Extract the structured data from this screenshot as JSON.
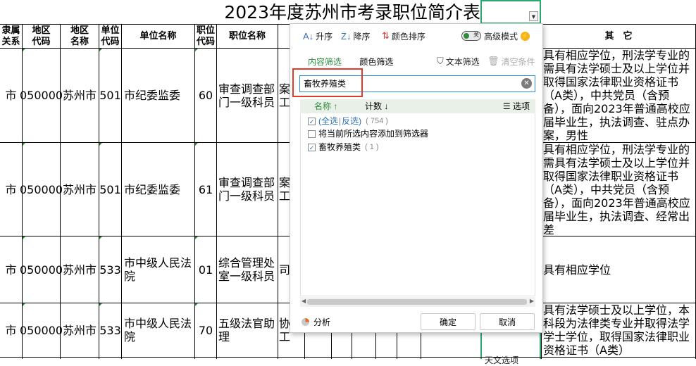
{
  "title": "2023年度苏州市考录职位简介表",
  "headers": {
    "jsgx": "隶属关系",
    "dqdm": "地区代码",
    "dqmc": "地区名称",
    "dwdm": "单位代码",
    "dwmc": "单位名称",
    "zwdm": "职位代码",
    "zwmc": "职位名称",
    "qt": "其　它"
  },
  "rows": [
    {
      "rel": "市",
      "area_code": "050000",
      "area": "苏州市",
      "unit_code": "501",
      "unit": "市纪委监委",
      "pos_code": "60",
      "pos": "审查调查部门一级科员",
      "fragment": "案工",
      "other": "具有相应学位，刑法学专业的需具有法学硕士及以上学位并取得国家法律职业资格证书（A类），中共党员（含预备），面向2023年普通高校应届毕业生，执法调查、驻点办案，男性"
    },
    {
      "rel": "市",
      "area_code": "050000",
      "area": "苏州市",
      "unit_code": "501",
      "unit": "市纪委监委",
      "pos_code": "61",
      "pos": "审查调查部门一级科员",
      "fragment": "案工",
      "other": "具有相应学位，刑法学专业的需具有法学硕士及以上学位并取得国家法律职业资格证书（A类），中共党员（含预备），面向2023年普通高校应届毕业生，执法调查、经常出差"
    },
    {
      "rel": "市",
      "area_code": "050000",
      "area": "苏州市",
      "unit_code": "533",
      "unit": "市中级人民法院",
      "pos_code": "01",
      "pos": "综合管理处室一级科员",
      "fragment": "司",
      "other": "具有相应学位"
    },
    {
      "rel": "市",
      "area_code": "050000",
      "area": "苏州市",
      "unit_code": "533",
      "unit": "市中级人民法院",
      "pos_code": "70",
      "pos": "五级法官助理",
      "fragment": "协工",
      "other": "具有法学硕士及以上学位，本科段为法律类专业并取得法学学士学位，取得国家法律职业资格证书（A类）"
    }
  ],
  "cut_text": "天文选项",
  "filter_panel": {
    "sort_asc": "升序",
    "sort_desc": "降序",
    "color_sort": "颜色排序",
    "toggle_text": "关",
    "advanced": "高级模式",
    "tab_content": "内容筛选",
    "tab_color": "颜色筛选",
    "text_filter": "文本筛选",
    "clear_condition": "清空条件",
    "search_value": "畜牧养殖类",
    "col_name": "名称",
    "col_count": "计数",
    "col_options": "选项",
    "select_all": "(全选",
    "invert": "反选)",
    "select_all_count": "( 754 )",
    "add_to_filter": "将当前所选内容添加到筛选器",
    "item_label": "畜牧养殖类",
    "item_count": "( 1 )",
    "analyze": "分析",
    "ok": "确定",
    "cancel": "取消"
  },
  "colors": {
    "accent": "#2e8b3e",
    "highlight": "#e03a2a",
    "selection": "#2aa86f"
  }
}
